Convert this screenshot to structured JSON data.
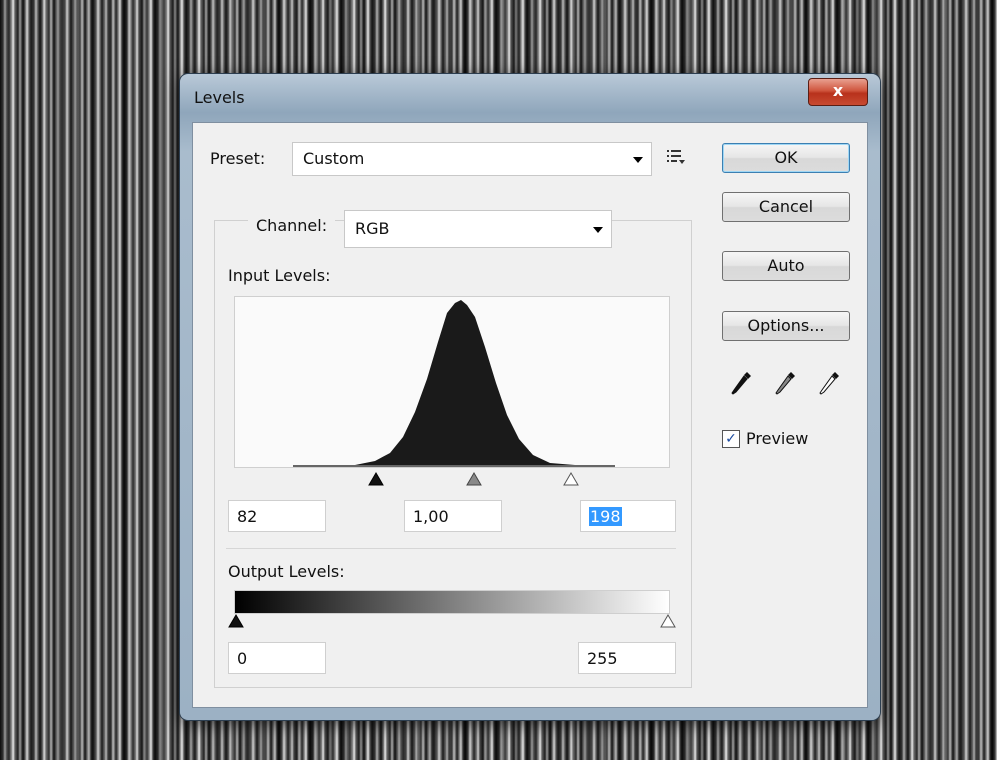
{
  "dialog": {
    "title": "Levels",
    "close_glyph": "x"
  },
  "preset": {
    "label": "Preset:",
    "value": "Custom"
  },
  "channel": {
    "label": "Channel:",
    "value": "RGB"
  },
  "input_levels": {
    "label": "Input Levels:",
    "black": "82",
    "gamma": "1,00",
    "white": "198"
  },
  "output_levels": {
    "label": "Output Levels:",
    "black": "0",
    "white": "255"
  },
  "buttons": {
    "ok": "OK",
    "cancel": "Cancel",
    "auto": "Auto",
    "options": "Options..."
  },
  "preview": {
    "label": "Preview",
    "checked": true
  },
  "icons": {
    "preset_menu": "preset-menu-icon",
    "black_eyedropper": "black-eyedropper-icon",
    "gray_eyedropper": "gray-eyedropper-icon",
    "white_eyedropper": "white-eyedropper-icon"
  }
}
